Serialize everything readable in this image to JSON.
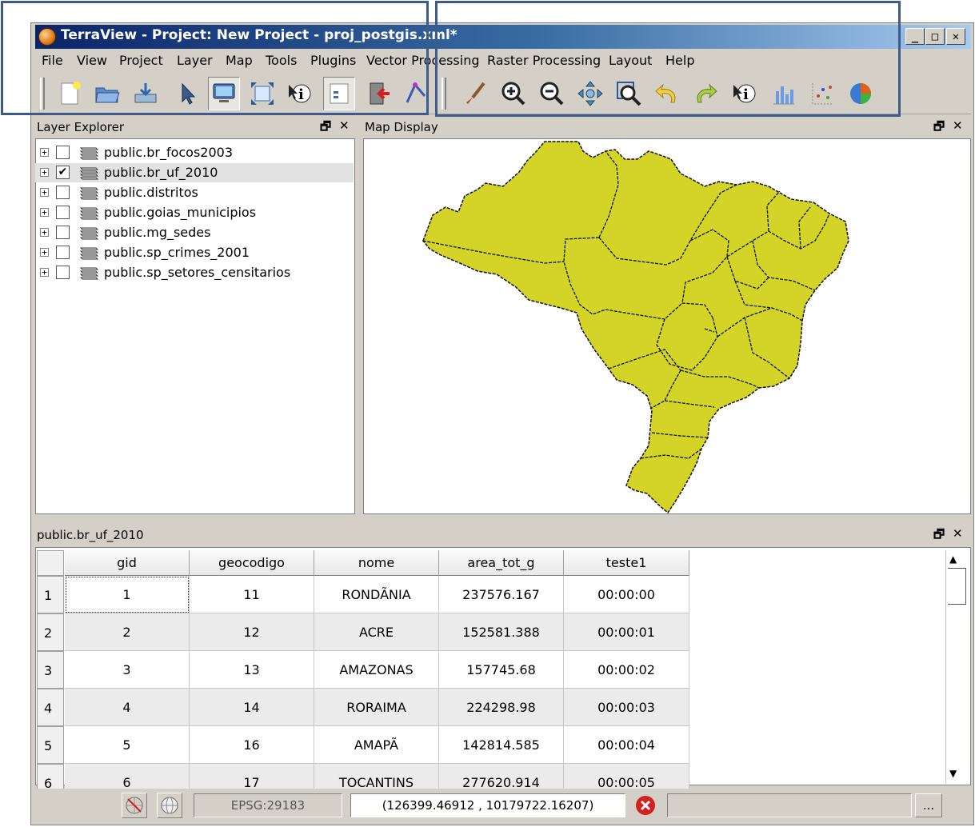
{
  "window": {
    "title": "TerraView - Project: New Project - proj_postgis.xml*",
    "minimize": "_",
    "maximize": "□",
    "close": "✕"
  },
  "menu": [
    "File",
    "View",
    "Project",
    "Layer",
    "Map",
    "Tools",
    "Plugins",
    "Vector Processing",
    "Raster Processing",
    "Layout",
    "Help"
  ],
  "toolbar": {
    "tools": [
      "new-project-icon",
      "open-project-icon",
      "save-project-icon",
      "select-pointer-icon",
      "display-icon",
      "zoom-extent-icon",
      "info-icon",
      "layer-list-icon",
      "exit-icon",
      "measure-icon",
      "brush-icon",
      "zoom-in-icon",
      "zoom-out-icon",
      "pan-icon",
      "zoom-area-icon",
      "undo-icon",
      "redo-icon",
      "info-tool-icon",
      "histogram-icon",
      "scatter-icon",
      "pie-chart-icon"
    ]
  },
  "layer_explorer": {
    "title": "Layer Explorer",
    "layers": [
      {
        "name": "public.br_focos2003",
        "checked": false
      },
      {
        "name": "public.br_uf_2010",
        "checked": true
      },
      {
        "name": "public.distritos",
        "checked": false
      },
      {
        "name": "public.goias_municipios",
        "checked": false
      },
      {
        "name": "public.mg_sedes",
        "checked": false
      },
      {
        "name": "public.sp_crimes_2001",
        "checked": false
      },
      {
        "name": "public.sp_setores_censitarios",
        "checked": false
      }
    ]
  },
  "map_display": {
    "title": "Map Display",
    "fill_color": "#d4d328"
  },
  "table": {
    "title": "public.br_uf_2010",
    "columns": [
      "gid",
      "geocodigo",
      "nome",
      "area_tot_g",
      "teste1"
    ],
    "rows": [
      {
        "n": "1",
        "gid": "1",
        "geocodigo": "11",
        "nome": "RONDÃNIA",
        "area_tot_g": "237576.167",
        "teste1": "00:00:00"
      },
      {
        "n": "2",
        "gid": "2",
        "geocodigo": "12",
        "nome": "ACRE",
        "area_tot_g": "152581.388",
        "teste1": "00:00:01"
      },
      {
        "n": "3",
        "gid": "3",
        "geocodigo": "13",
        "nome": "AMAZONAS",
        "area_tot_g": "157745.68",
        "teste1": "00:00:02"
      },
      {
        "n": "4",
        "gid": "4",
        "geocodigo": "14",
        "nome": "RORAIMA",
        "area_tot_g": "224298.98",
        "teste1": "00:00:03"
      },
      {
        "n": "5",
        "gid": "5",
        "geocodigo": "16",
        "nome": "AMAPÃ",
        "area_tot_g": "142814.585",
        "teste1": "00:00:04"
      },
      {
        "n": "6",
        "gid": "6",
        "geocodigo": "17",
        "nome": "TOCANTINS",
        "area_tot_g": "277620.914",
        "teste1": "00:00:05"
      }
    ]
  },
  "status": {
    "srs": "EPSG:29183",
    "coordinates": "(126399.46912 , 10179722.16207)",
    "more": "..."
  }
}
